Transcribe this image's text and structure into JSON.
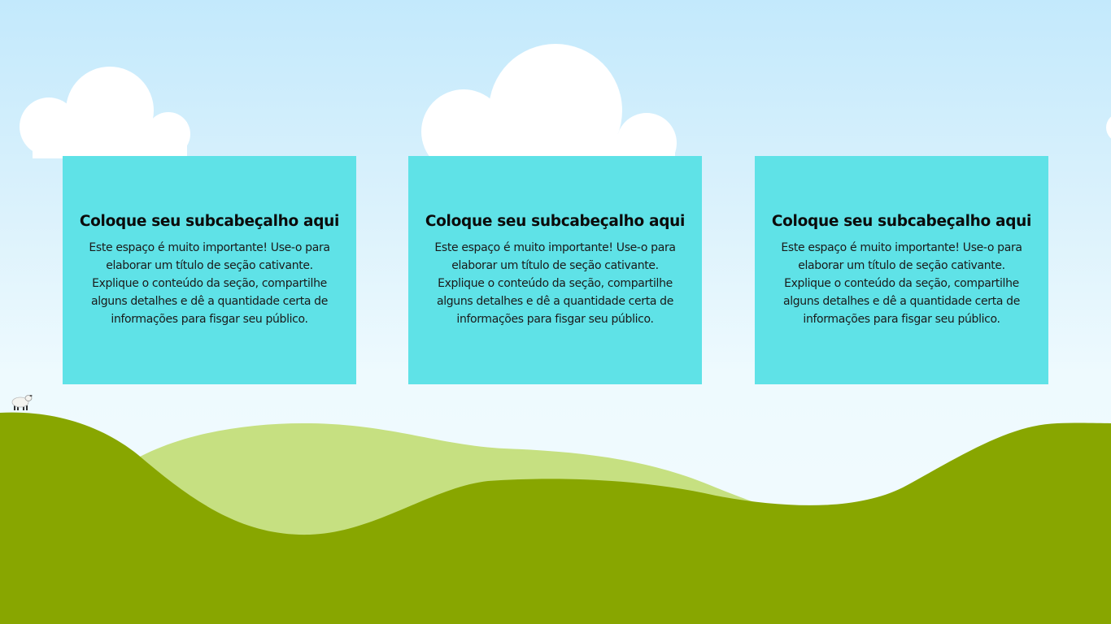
{
  "colors": {
    "sky_top": "#c3e9fc",
    "sky_bottom": "#f2fbff",
    "card_bg": "#5fe2e7",
    "hill_dark": "#88a600",
    "hill_light": "#c6e081",
    "cloud": "#ffffff"
  },
  "cards": [
    {
      "heading": "Coloque seu subcabeçalho aqui",
      "body": "Este espaço é muito importante! Use-o para elaborar um título de seção cativante. Explique o conteúdo da seção, compartilhe alguns detalhes e dê a quantidade certa de informações para fisgar seu público."
    },
    {
      "heading": "Coloque seu subcabeçalho aqui",
      "body": "Este espaço é muito importante! Use-o para elaborar um título de seção cativante. Explique o conteúdo da seção, compartilhe alguns detalhes e dê a quantidade certa de informações para fisgar seu público."
    },
    {
      "heading": "Coloque seu subcabeçalho aqui",
      "body": "Este espaço é muito importante! Use-o para elaborar um título de seção cativante. Explique o conteúdo da seção, compartilhe alguns detalhes e dê a quantidade certa de informações para fisgar seu público."
    }
  ],
  "icons": {
    "sheep": "sheep-icon",
    "cloud": "cloud-icon"
  }
}
